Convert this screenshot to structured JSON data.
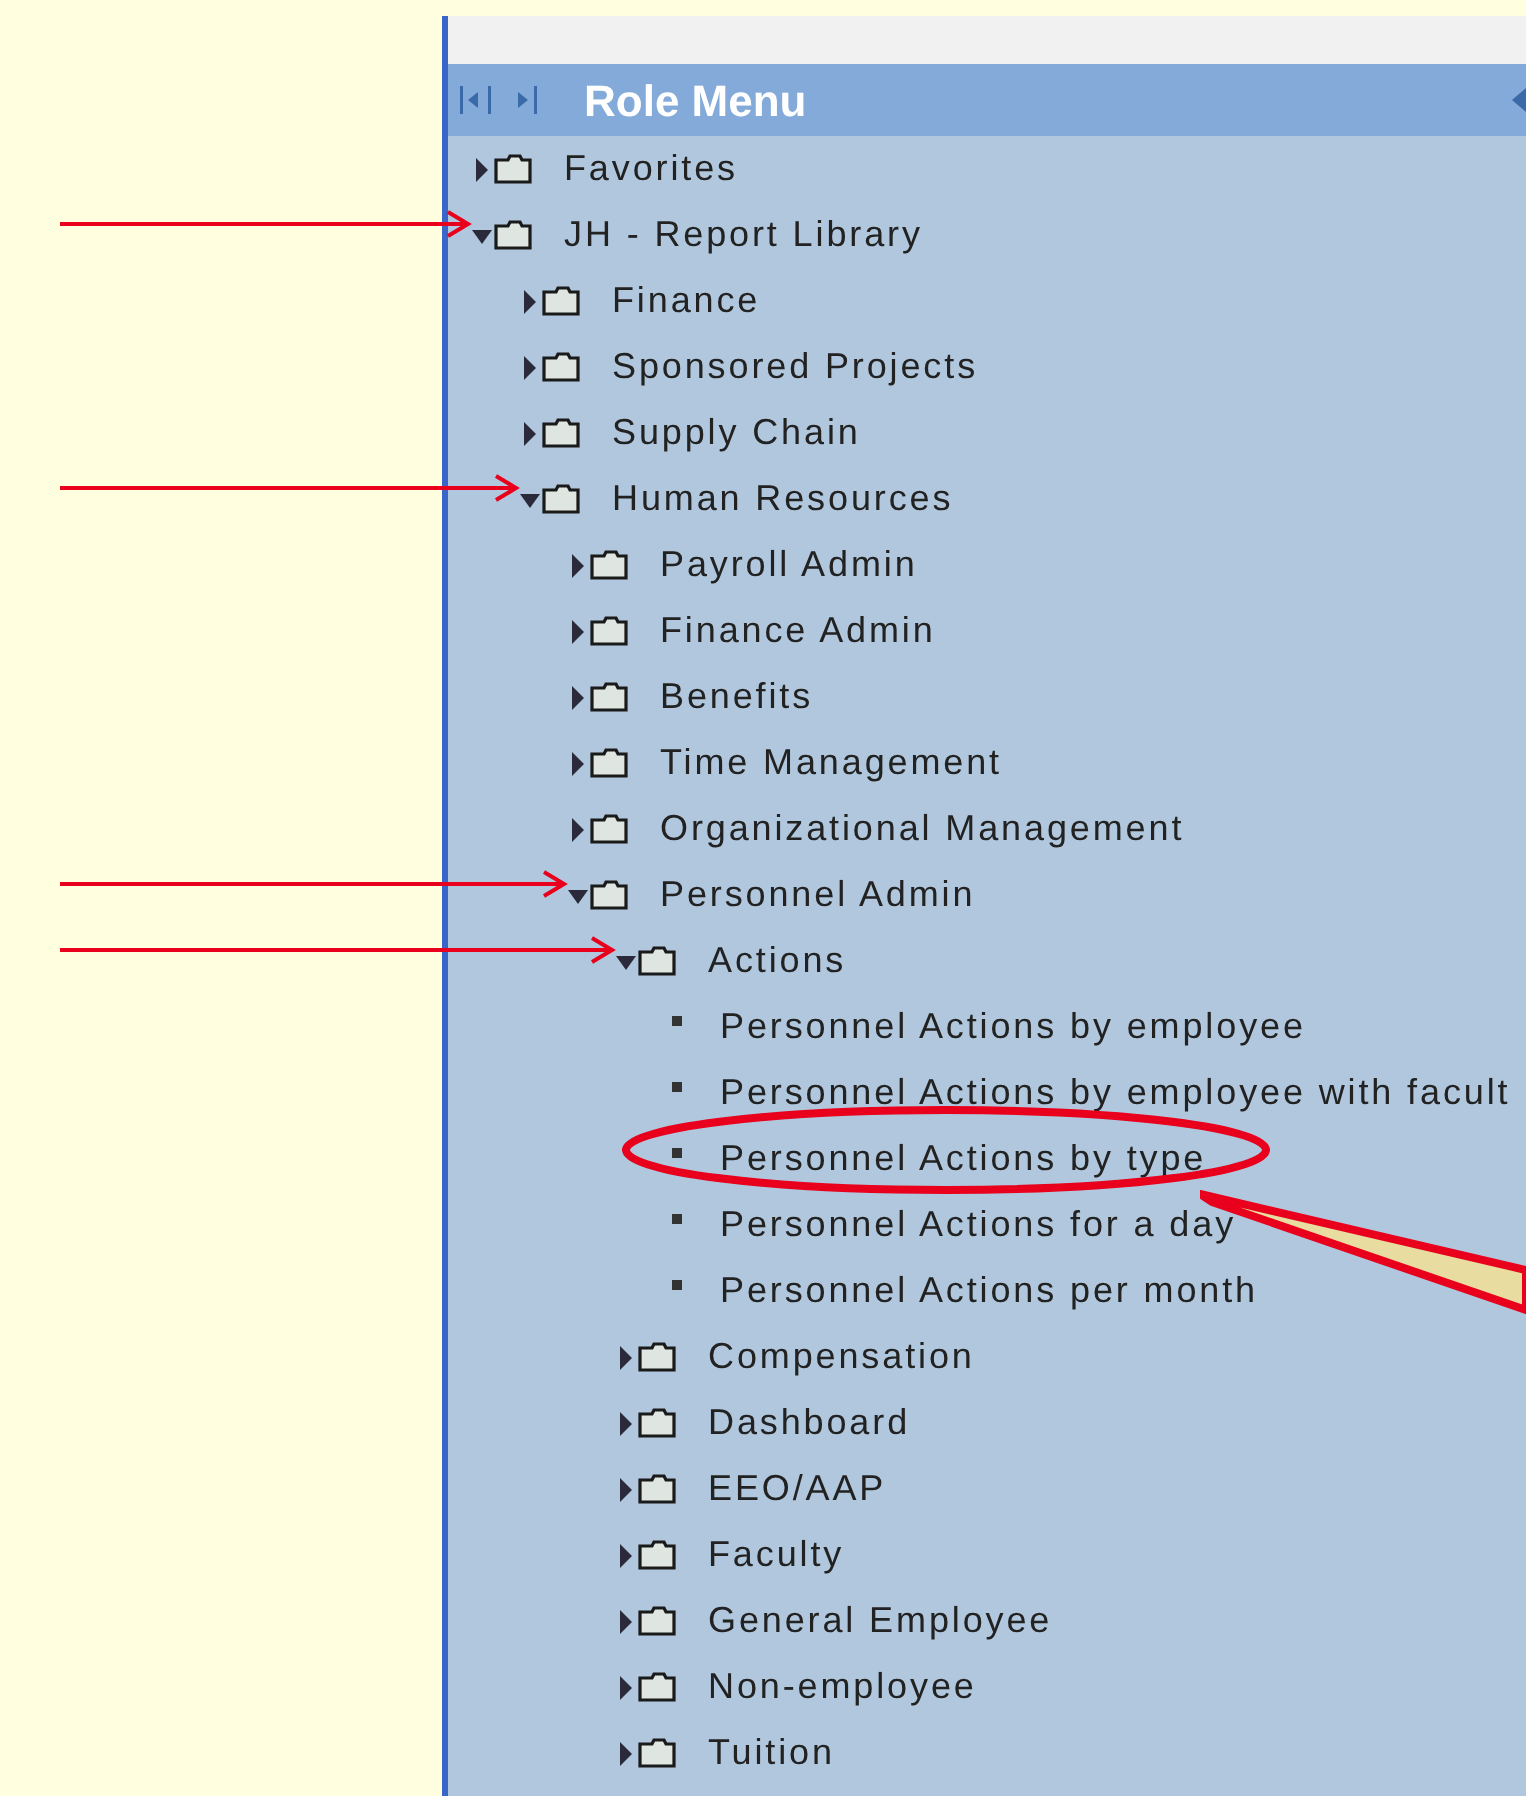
{
  "panel": {
    "title": "Role Menu"
  },
  "tree": [
    {
      "label": "Favorites",
      "kind": "folder",
      "expanded": false,
      "marked": false
    },
    {
      "label": "JH - Report Library",
      "kind": "folder",
      "expanded": true,
      "marked": true,
      "children": [
        {
          "label": "Finance",
          "kind": "folder",
          "expanded": false,
          "marked": false
        },
        {
          "label": "Sponsored Projects",
          "kind": "folder",
          "expanded": false,
          "marked": false
        },
        {
          "label": "Supply Chain",
          "kind": "folder",
          "expanded": false,
          "marked": false
        },
        {
          "label": "Human Resources",
          "kind": "folder",
          "expanded": true,
          "marked": true,
          "children": [
            {
              "label": "Payroll Admin",
              "kind": "folder",
              "expanded": false,
              "marked": false
            },
            {
              "label": "Finance Admin",
              "kind": "folder",
              "expanded": false,
              "marked": false
            },
            {
              "label": "Benefits",
              "kind": "folder",
              "expanded": false,
              "marked": false
            },
            {
              "label": "Time Management",
              "kind": "folder",
              "expanded": false,
              "marked": false
            },
            {
              "label": "Organizational Management",
              "kind": "folder",
              "expanded": false,
              "marked": false
            },
            {
              "label": "Personnel Admin",
              "kind": "folder",
              "expanded": true,
              "marked": true,
              "children": [
                {
                  "label": "Actions",
                  "kind": "folder",
                  "expanded": true,
                  "marked": true,
                  "children": [
                    {
                      "label": "Personnel Actions by employee",
                      "kind": "leaf",
                      "circled": false
                    },
                    {
                      "label": "Personnel Actions by employee with facult",
                      "kind": "leaf",
                      "circled": false
                    },
                    {
                      "label": "Personnel Actions by type",
                      "kind": "leaf",
                      "circled": true
                    },
                    {
                      "label": "Personnel Actions for a day",
                      "kind": "leaf",
                      "circled": false
                    },
                    {
                      "label": "Personnel Actions per month",
                      "kind": "leaf",
                      "circled": false
                    }
                  ]
                },
                {
                  "label": "Compensation",
                  "kind": "folder",
                  "expanded": false,
                  "marked": false
                },
                {
                  "label": "Dashboard",
                  "kind": "folder",
                  "expanded": false,
                  "marked": false
                },
                {
                  "label": "EEO/AAP",
                  "kind": "folder",
                  "expanded": false,
                  "marked": false
                },
                {
                  "label": "Faculty",
                  "kind": "folder",
                  "expanded": false,
                  "marked": false
                },
                {
                  "label": "General Employee",
                  "kind": "folder",
                  "expanded": false,
                  "marked": false
                },
                {
                  "label": "Non-employee",
                  "kind": "folder",
                  "expanded": false,
                  "marked": false
                },
                {
                  "label": "Tuition",
                  "kind": "folder",
                  "expanded": false,
                  "marked": false
                }
              ]
            }
          ]
        }
      ]
    }
  ]
}
